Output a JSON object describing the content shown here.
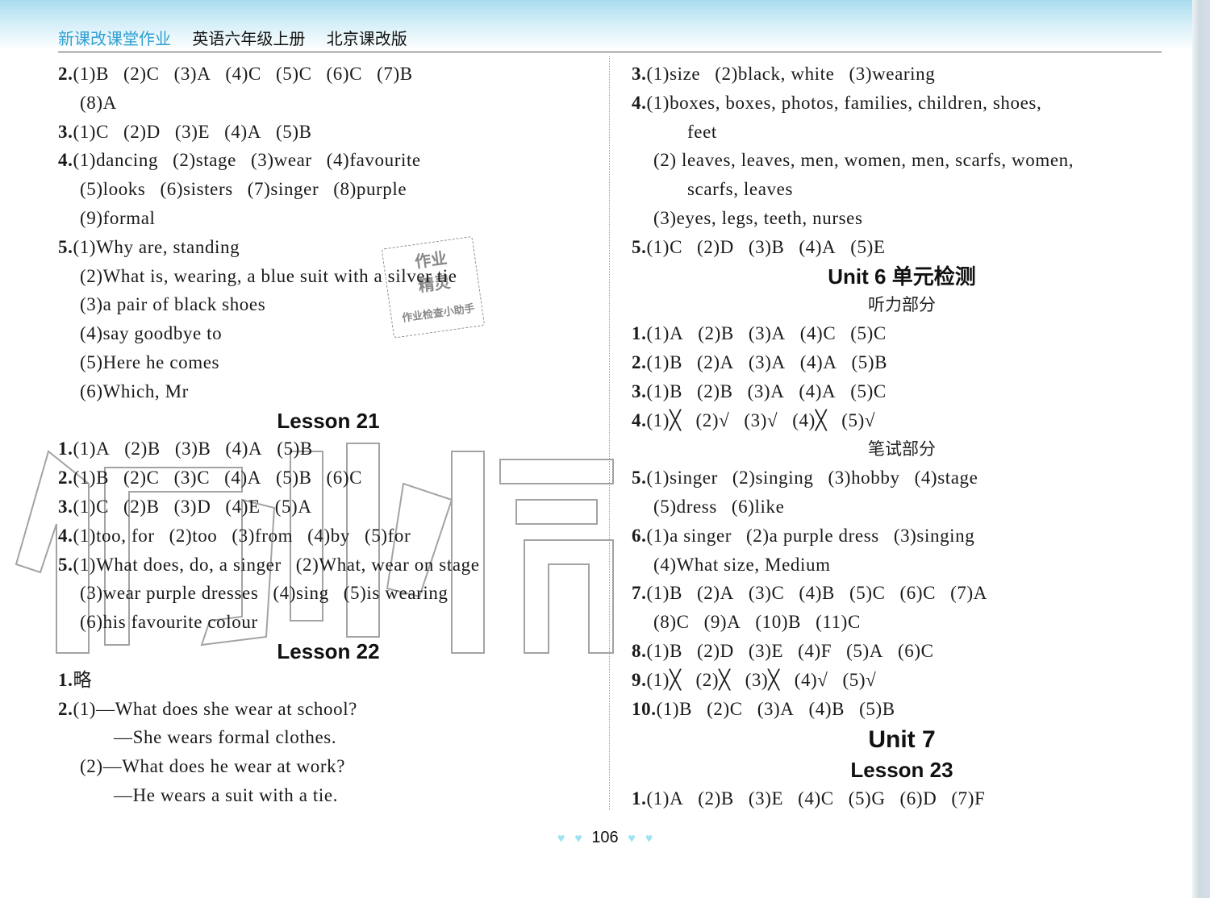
{
  "header": {
    "series": "新课改课堂作业",
    "book": "英语六年级上册",
    "edition": "北京课改版"
  },
  "left": {
    "block1": {
      "q2": {
        "num": "2.",
        "items": [
          "(1)B",
          "(2)C",
          "(3)A",
          "(4)C",
          "(5)C",
          "(6)C",
          "(7)B"
        ],
        "cont": [
          "(8)A"
        ]
      },
      "q3": {
        "num": "3.",
        "items": [
          "(1)C",
          "(2)D",
          "(3)E",
          "(4)A",
          "(5)B"
        ]
      },
      "q4": {
        "num": "4.",
        "line1": [
          "(1)dancing",
          "(2)stage",
          "(3)wear",
          "(4)favourite"
        ],
        "line2": [
          "(5)looks",
          "(6)sisters",
          "(7)singer",
          "(8)purple"
        ],
        "line3": [
          "(9)formal"
        ]
      },
      "q5": {
        "num": "5.",
        "lines": [
          "(1)Why are, standing",
          "(2)What is, wearing, a blue suit with a silver tie",
          "(3)a pair of black shoes",
          "(4)say goodbye to",
          "(5)Here he comes",
          "(6)Which, Mr"
        ]
      }
    },
    "lesson21": {
      "title": "Lesson 21",
      "q1": {
        "num": "1.",
        "items": [
          "(1)A",
          "(2)B",
          "(3)B",
          "(4)A",
          "(5)B"
        ]
      },
      "q2": {
        "num": "2.",
        "items": [
          "(1)B",
          "(2)C",
          "(3)C",
          "(4)A",
          "(5)B",
          "(6)C"
        ]
      },
      "q3": {
        "num": "3.",
        "items": [
          "(1)C",
          "(2)B",
          "(3)D",
          "(4)E",
          "(5)A"
        ]
      },
      "q4": {
        "num": "4.",
        "items": [
          "(1)too, for",
          "(2)too",
          "(3)from",
          "(4)by",
          "(5)for"
        ]
      },
      "q5": {
        "num": "5.",
        "line1": [
          "(1)What does, do, a singer",
          "(2)What, wear on stage"
        ],
        "line2": [
          "(3)wear purple dresses",
          "(4)sing",
          "(5)is wearing"
        ],
        "line3": [
          "(6)his favourite colour"
        ]
      }
    },
    "lesson22": {
      "title": "Lesson 22",
      "q1": {
        "num": "1.",
        "text": "略"
      },
      "q2": {
        "num": "2.",
        "lines": [
          "(1)—What does she wear at school?",
          "—She wears formal clothes.",
          "(2)—What does he wear at work?",
          "—He wears a suit with a tie."
        ]
      }
    }
  },
  "right": {
    "block1": {
      "q3": {
        "num": "3.",
        "items": [
          "(1)size",
          "(2)black, white",
          "(3)wearing"
        ]
      },
      "q4": {
        "num": "4.",
        "lines": [
          "(1)boxes, boxes, photos, families, children, shoes,",
          "feet",
          "(2) leaves, leaves, men, women, men, scarfs, women,",
          "scarfs, leaves",
          "(3)eyes, legs, teeth, nurses"
        ]
      },
      "q5": {
        "num": "5.",
        "items": [
          "(1)C",
          "(2)D",
          "(3)B",
          "(4)A",
          "(5)E"
        ]
      }
    },
    "unit6": {
      "title": "Unit 6 单元检测",
      "listening": "听力部分",
      "q1": {
        "num": "1.",
        "items": [
          "(1)A",
          "(2)B",
          "(3)A",
          "(4)C",
          "(5)C"
        ]
      },
      "q2": {
        "num": "2.",
        "items": [
          "(1)B",
          "(2)A",
          "(3)A",
          "(4)A",
          "(5)B"
        ]
      },
      "q3": {
        "num": "3.",
        "items": [
          "(1)B",
          "(2)B",
          "(3)A",
          "(4)A",
          "(5)C"
        ]
      },
      "q4": {
        "num": "4.",
        "items": [
          "(1)╳",
          "(2)√",
          "(3)√",
          "(4)╳",
          "(5)√"
        ]
      },
      "written": "笔试部分",
      "q5": {
        "num": "5.",
        "line1": [
          "(1)singer",
          "(2)singing",
          "(3)hobby",
          "(4)stage"
        ],
        "line2": [
          "(5)dress",
          "(6)like"
        ]
      },
      "q6": {
        "num": "6.",
        "line1": [
          "(1)a singer",
          "(2)a purple dress",
          "(3)singing"
        ],
        "line2": [
          "(4)What size, Medium"
        ]
      },
      "q7": {
        "num": "7.",
        "line1": [
          "(1)B",
          "(2)A",
          "(3)C",
          "(4)B",
          "(5)C",
          "(6)C",
          "(7)A"
        ],
        "line2": [
          "(8)C",
          "(9)A",
          "(10)B",
          "(11)C"
        ]
      },
      "q8": {
        "num": "8.",
        "items": [
          "(1)B",
          "(2)D",
          "(3)E",
          "(4)F",
          "(5)A",
          "(6)C"
        ]
      },
      "q9": {
        "num": "9.",
        "items": [
          "(1)╳",
          "(2)╳",
          "(3)╳",
          "(4)√",
          "(5)√"
        ]
      },
      "q10": {
        "num": "10.",
        "items": [
          "(1)B",
          "(2)C",
          "(3)A",
          "(4)B",
          "(5)B"
        ]
      }
    },
    "unit7": {
      "title": "Unit 7",
      "lesson23": {
        "title": "Lesson 23",
        "q1": {
          "num": "1.",
          "items": [
            "(1)A",
            "(2)B",
            "(3)E",
            "(4)C",
            "(5)G",
            "(6)D",
            "(7)F"
          ]
        }
      }
    }
  },
  "stamp": {
    "line1": "作业",
    "line2": "精灵",
    "line3": "作业检查小助手"
  },
  "watermark": {
    "text": "作业精灵"
  },
  "footer": {
    "page_number": "106"
  }
}
